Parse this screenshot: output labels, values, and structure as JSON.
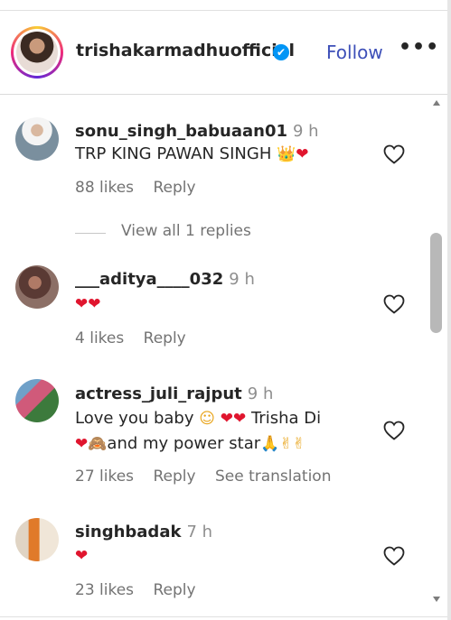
{
  "header": {
    "username": "trishakarmadhuofficial",
    "verified_glyph": "✔",
    "follow_label": "Follow",
    "more_label": "•••"
  },
  "comments": [
    {
      "username": "sonu_singh_babuaan01",
      "time": "9 h",
      "text": "TRP KING PAWAN SINGH",
      "emojis": [
        "crown",
        "red-heart"
      ],
      "likes": "88 likes",
      "reply": "Reply"
    },
    {
      "username": "___aditya____032",
      "time": "9 h",
      "text": "",
      "emojis": [
        "red-heart",
        "red-heart"
      ],
      "likes": "4 likes",
      "reply": "Reply"
    },
    {
      "username": "actress_juli_rajput",
      "time": "9 h",
      "text_line1_a": "Love you baby",
      "text_line1_b": "Trisha Di",
      "text_line2": "and my power star",
      "likes": "27 likes",
      "reply": "Reply",
      "translate": "See translation"
    },
    {
      "username": "singhbadak",
      "time": "7 h",
      "text": "",
      "emojis": [
        "red-heart"
      ],
      "likes": "23 likes",
      "reply": "Reply"
    }
  ],
  "view_replies": "View all 1 replies",
  "colors": {
    "follow": "#3d4fb8",
    "verified": "#0095f6",
    "heart": "#e0152e",
    "muted": "#737373"
  }
}
